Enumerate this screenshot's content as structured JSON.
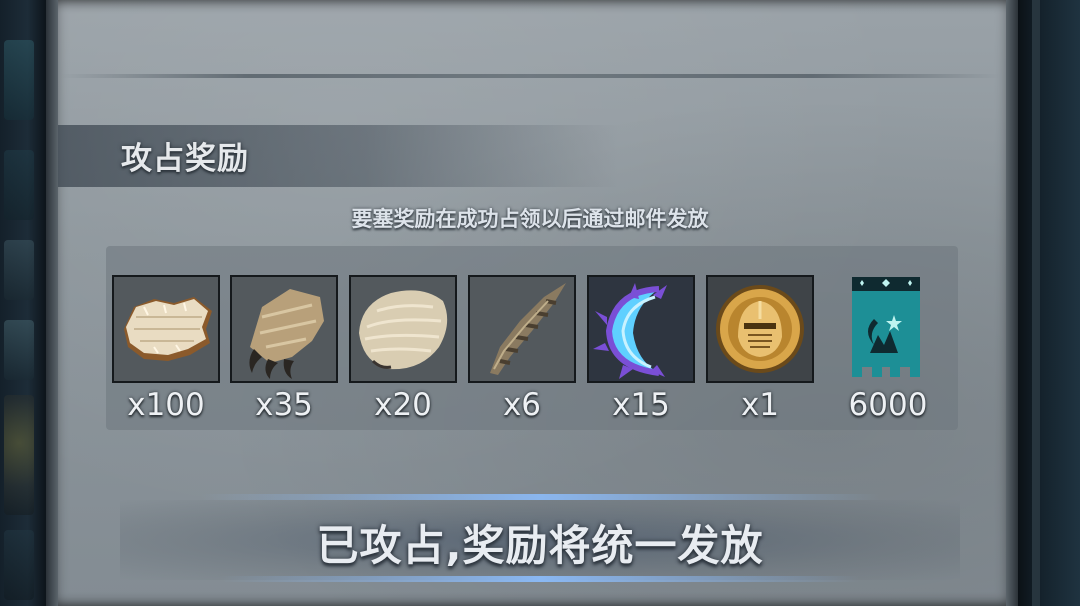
{
  "section": {
    "title": "攻占奖励",
    "notice": "要塞奖励在成功占领以后通过邮件发放"
  },
  "rewards": [
    {
      "icon": "hide-pelt-icon",
      "quantity": "x100"
    },
    {
      "icon": "claw-paw-icon",
      "quantity": "x35"
    },
    {
      "icon": "fur-pelt-icon",
      "quantity": "x20"
    },
    {
      "icon": "twisted-horn-icon",
      "quantity": "x6"
    },
    {
      "icon": "blue-crescent-icon",
      "quantity": "x15"
    },
    {
      "icon": "golden-knight-medal-icon",
      "quantity": "x1"
    },
    {
      "icon": "guild-banner-icon",
      "quantity": "6000"
    }
  ],
  "status": {
    "text": "已攻占,奖励将统一发放"
  },
  "colors": {
    "panel": "#8d969c",
    "text": "#e6e9ec",
    "accent_glow": "#8cbeff",
    "banner_teal": "#1d8f96"
  }
}
